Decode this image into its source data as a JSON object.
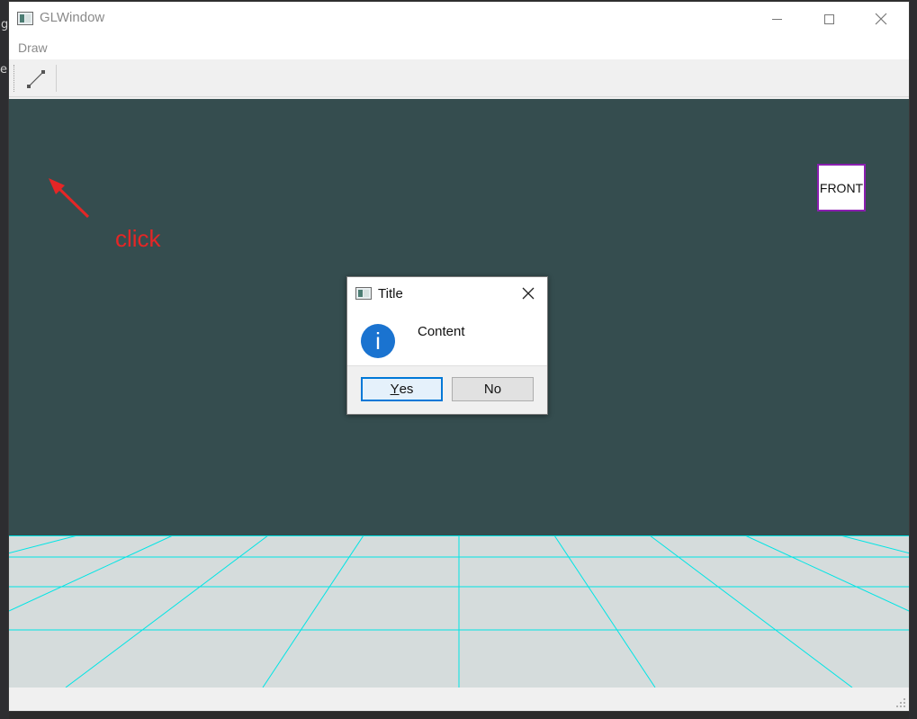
{
  "window": {
    "title": "GLWindow",
    "menu": [
      "Draw"
    ],
    "toolbar": {
      "tools": [
        {
          "icon": "line-tool-icon",
          "active": false
        }
      ]
    },
    "accent_color": "#0078d7",
    "viewport_background": "#354d4f",
    "grid_color": "#00e5e5",
    "floor_color": "#d5dcdc"
  },
  "viewcube": {
    "label": "FRONT"
  },
  "annotation": {
    "text": "click",
    "color": "#e52626"
  },
  "dialog": {
    "title": "Title",
    "icon": "information-icon",
    "content": "Content",
    "buttons": {
      "yes_mnemonic": "Y",
      "yes_rest": "es",
      "no_label": "No"
    }
  },
  "background_glyphs": [
    "g",
    "e"
  ]
}
